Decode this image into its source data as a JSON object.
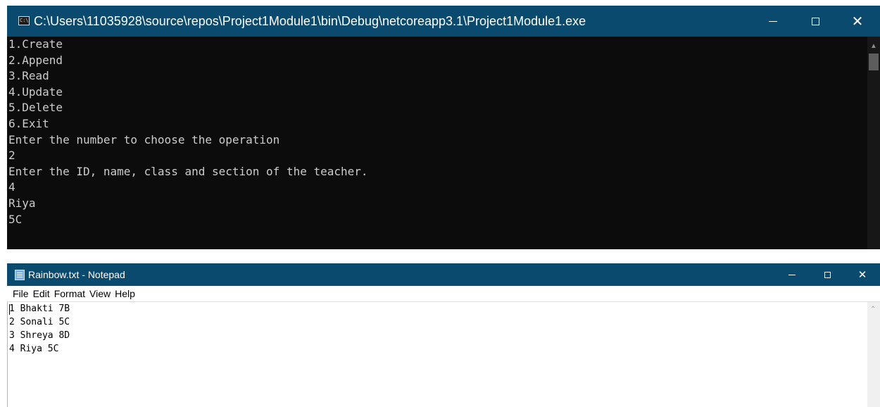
{
  "console": {
    "title": "C:\\Users\\11035928\\source\\repos\\Project1Module1\\bin\\Debug\\netcoreapp3.1\\Project1Module1.exe",
    "lines": [
      "1.Create",
      "2.Append",
      "3.Read",
      "4.Update",
      "5.Delete",
      "6.Exit",
      "Enter the number to choose the operation",
      "2",
      "Enter the ID, name, class and section of the teacher.",
      "4",
      "Riya",
      "5C"
    ]
  },
  "notepad": {
    "title": "Rainbow.txt - Notepad",
    "menu": [
      "File",
      "Edit",
      "Format",
      "View",
      "Help"
    ],
    "lines": [
      "1 Bhakti 7B",
      "2 Sonali 5C",
      "3 Shreya 8D",
      "4 Riya 5C"
    ]
  },
  "colors": {
    "titlebar": "#0b4a6f",
    "console_bg": "#0c0c0c",
    "console_text": "#cccccc"
  }
}
